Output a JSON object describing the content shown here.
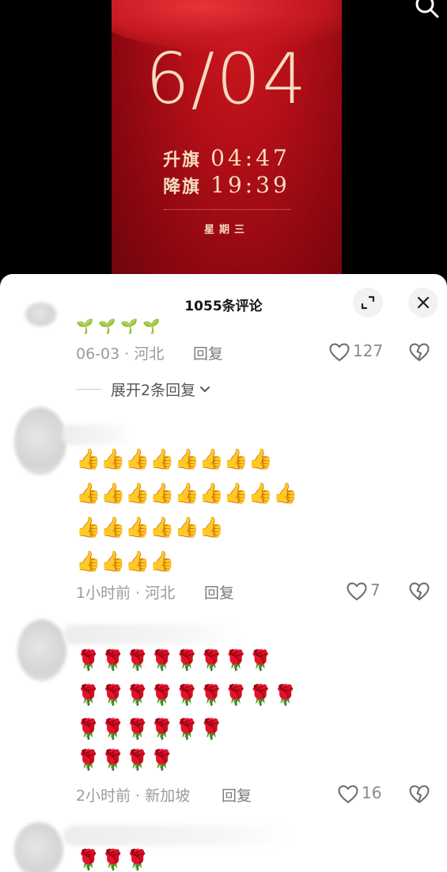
{
  "video": {
    "date": "6/04",
    "raise_label": "升旗",
    "raise_time": "04:47",
    "lower_label": "降旗",
    "lower_time": "19:39",
    "weekday": "星期三",
    "accent_color": "#b30f17",
    "text_color": "#f4dcc2"
  },
  "sheet": {
    "title": "1055条评论",
    "expand_icon": "expand-icon",
    "close_icon": "close-icon"
  },
  "comments": [
    {
      "emoji_rows": [
        "🌱 🌱 🌱 🌱"
      ],
      "date": "06-03",
      "location": "河北",
      "reply_label": "回复",
      "likes": "127",
      "expand_replies": "展开2条回复"
    },
    {
      "emoji_rows": [
        "👍👍👍👍👍👍👍👍",
        "👍👍👍👍👍👍👍👍👍",
        "👍👍👍👍👍👍",
        "👍👍👍👍"
      ],
      "date": "1小时前",
      "location": "河北",
      "reply_label": "回复",
      "likes": "7"
    },
    {
      "emoji_rows": [
        "🌹🌹🌹🌹🌹🌹🌹🌹",
        "🌹🌹🌹🌹🌹🌹🌹🌹🌹",
        "🌹🌹🌹🌹🌹🌹",
        "🌹🌹🌹🌹"
      ],
      "date": "2小时前",
      "location": "新加坡",
      "reply_label": "回复",
      "likes": "16"
    },
    {
      "emoji_rows": [
        "🌹🌹🌹"
      ]
    }
  ]
}
